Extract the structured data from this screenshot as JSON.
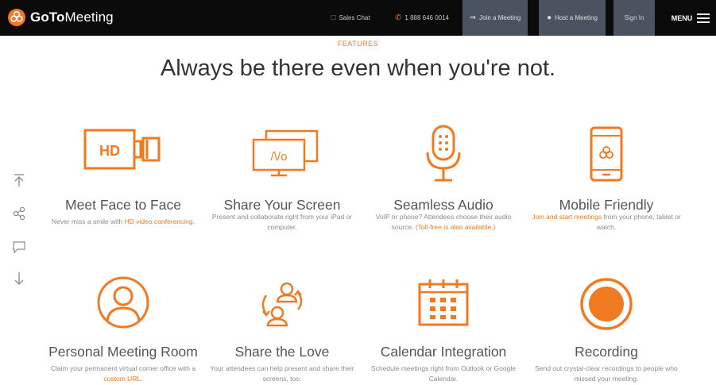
{
  "header": {
    "brand_bold": "GoTo",
    "brand_light": "Meeting",
    "sales_chat": "Sales Chat",
    "phone": "1 888 646 0014",
    "join": "Join a Meeting",
    "host": "Host a Meeting",
    "sign_in": "Sign In",
    "menu": "MENU"
  },
  "hero": {
    "eyebrow": "FEATURES",
    "headline": "Always be there even when you're not."
  },
  "side_icons": [
    "arrow-up-to-top-icon",
    "share-icon",
    "chat-icon",
    "arrow-down-icon"
  ],
  "features": [
    {
      "title": "Meet Face to Face",
      "desc_before": "Never miss a smile with ",
      "desc_link": "HD video conferencing",
      "desc_after": ".",
      "icon_text": "HD"
    },
    {
      "title": "Share Your Screen",
      "desc_before": "Present and collaborate right from your iPad or computer.",
      "desc_link": "",
      "desc_after": "",
      "icon_text": "/\\/o"
    },
    {
      "title": "Seamless Audio",
      "desc_before": "VoIP or phone? Attendees choose their audio source. ",
      "desc_link": "(Toll-free is also available.)",
      "desc_after": ""
    },
    {
      "title": "Mobile Friendly",
      "desc_before": "",
      "desc_link": "Join and start meetings",
      "desc_after": " from your phone, tablet or watch."
    },
    {
      "title": "Personal Meeting Room",
      "desc_before": "Claim your permanent virtual corner office with a ",
      "desc_link": "custom URL",
      "desc_after": "."
    },
    {
      "title": "Share the Love",
      "desc_before": "Your attendees can help present and share their screens, too.",
      "desc_link": "",
      "desc_after": ""
    },
    {
      "title": "Calendar Integration",
      "desc_before": "Schedule meetings right from Outlook or Google Calendar.",
      "desc_link": "",
      "desc_after": ""
    },
    {
      "title": "Recording",
      "desc_before": "Send out crystal-clear recordings to people who missed your meeting.",
      "desc_link": "",
      "desc_after": ""
    }
  ],
  "colors": {
    "accent": "#f07a22",
    "topbar": "#0b0b0b",
    "nav_button": "#4b5360"
  }
}
